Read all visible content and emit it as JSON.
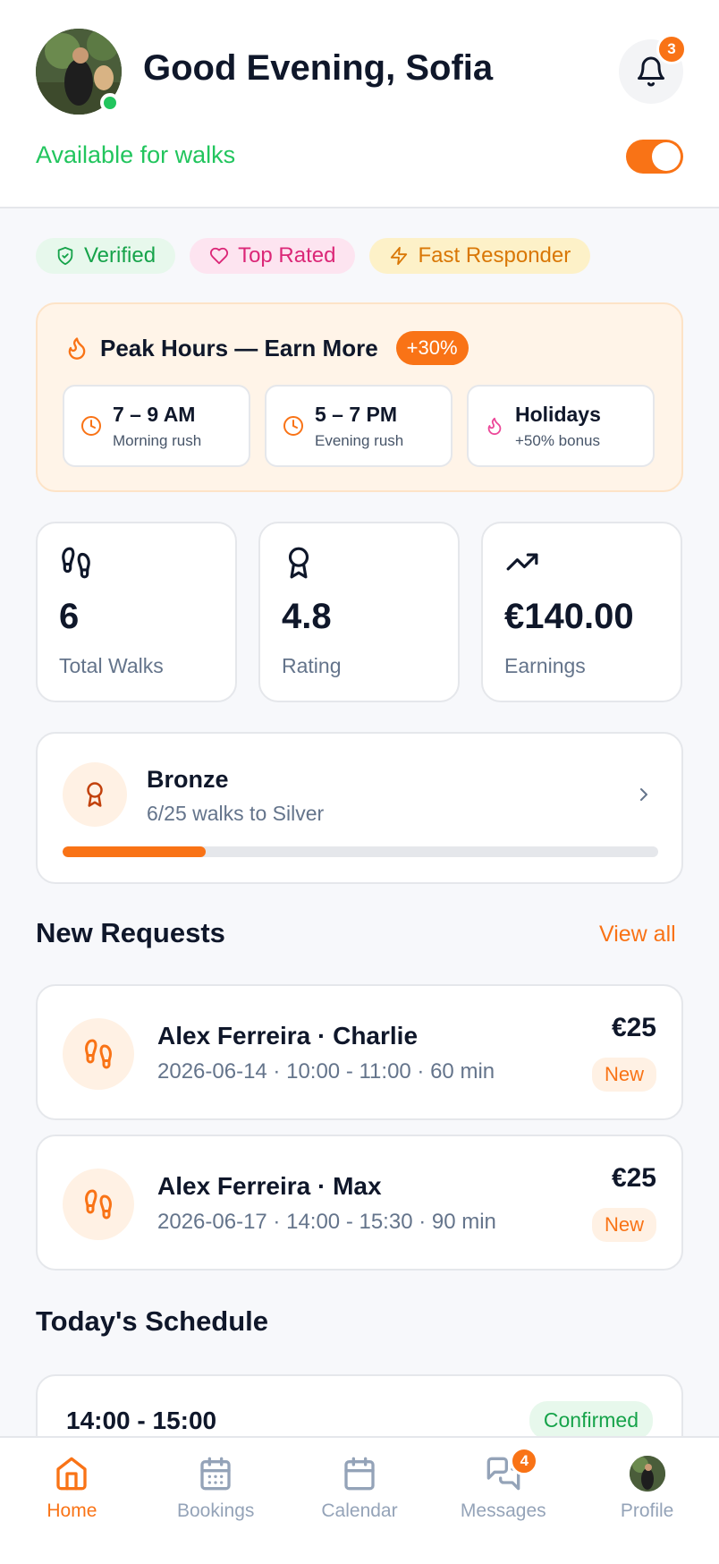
{
  "header": {
    "greeting": "Good Evening, Sofia",
    "notification_count": "3",
    "availability_label": "Available for walks",
    "availability_on": true
  },
  "badges": [
    {
      "label": "Verified",
      "icon": "shield-check-icon",
      "color": "#16a34a"
    },
    {
      "label": "Top Rated",
      "icon": "heart-icon",
      "color": "#db2777"
    },
    {
      "label": "Fast Responder",
      "icon": "lightning-icon",
      "color": "#d97706"
    }
  ],
  "peak": {
    "title": "Peak Hours — Earn More",
    "bonus": "+30%",
    "slots": [
      {
        "time": "7 – 9 AM",
        "sub": "Morning rush",
        "icon": "clock-icon"
      },
      {
        "time": "5 – 7 PM",
        "sub": "Evening rush",
        "icon": "clock-icon"
      },
      {
        "time": "Holidays",
        "sub": "+50% bonus",
        "icon": "flame-icon"
      }
    ]
  },
  "stats": [
    {
      "value": "6",
      "label": "Total Walks",
      "icon": "footprints-icon"
    },
    {
      "value": "4.8",
      "label": "Rating",
      "icon": "award-icon"
    },
    {
      "value": "€140.00",
      "label": "Earnings",
      "icon": "trending-up-icon"
    }
  ],
  "tier": {
    "name": "Bronze",
    "progress_text": "6/25 walks to Silver",
    "progress_fraction": 0.24
  },
  "requests_section": {
    "title": "New Requests",
    "view_all": "View all"
  },
  "requests": [
    {
      "title": "Alex Ferreira · Charlie",
      "sub": "2026-06-14 · 10:00 - 11:00 · 60 min",
      "price": "€25",
      "status": "New"
    },
    {
      "title": "Alex Ferreira · Max",
      "sub": "2026-06-17 · 14:00 - 15:30 · 90 min",
      "price": "€25",
      "status": "New"
    }
  ],
  "schedule_section": {
    "title": "Today's Schedule"
  },
  "schedule": [
    {
      "time": "14:00 - 15:00",
      "status": "Confirmed"
    }
  ],
  "nav": {
    "items": [
      {
        "label": "Home",
        "icon": "home-icon",
        "active": true
      },
      {
        "label": "Bookings",
        "icon": "calendar-grid-icon"
      },
      {
        "label": "Calendar",
        "icon": "calendar-icon"
      },
      {
        "label": "Messages",
        "icon": "messages-icon",
        "badge": "4"
      },
      {
        "label": "Profile",
        "icon": "avatar"
      }
    ]
  },
  "colors": {
    "accent": "#f97316",
    "success": "#22c55e",
    "text": "#0f172a",
    "muted": "#64748b"
  }
}
